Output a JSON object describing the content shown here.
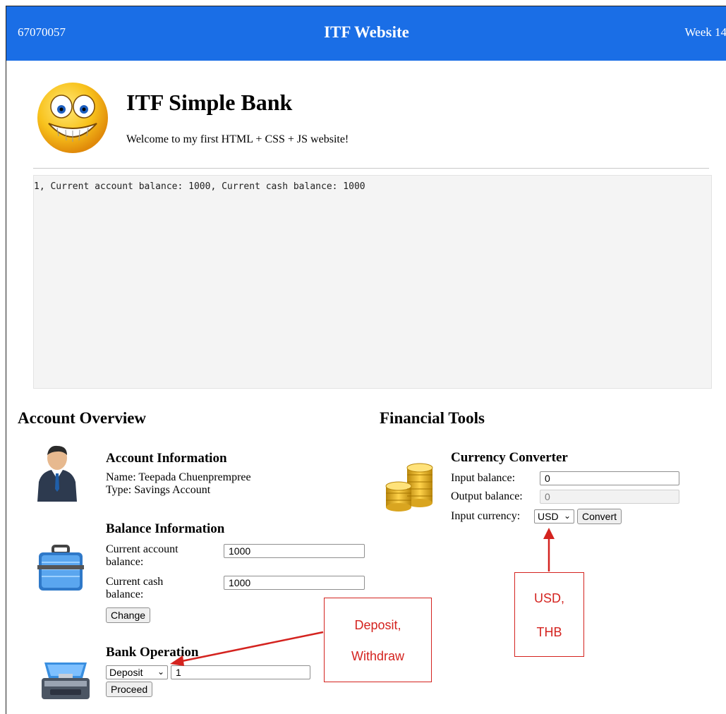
{
  "header": {
    "student_id": "67070057",
    "site_title": "ITF Website",
    "week": "Week 14"
  },
  "hero": {
    "title": "ITF Simple Bank",
    "welcome": "Welcome to my first HTML + CSS + JS website!"
  },
  "log": {
    "text": "1, Current account balance: 1000, Current cash balance: 1000"
  },
  "account_overview": {
    "title": "Account Overview",
    "account_information": {
      "title": "Account Information",
      "name": "Name: Teepada Chuenprempree",
      "type": "Type: Savings Account"
    },
    "balance_information": {
      "title": "Balance Information",
      "account_balance_label_1": "Current account",
      "account_balance_label_2": "balance:",
      "account_balance_value": "1000",
      "cash_balance_label_1": "Current cash",
      "cash_balance_label_2": "balance:",
      "cash_balance_value": "1000",
      "change_label": "Change"
    },
    "bank_operation": {
      "title": "Bank Operation",
      "operation_selected": "Deposit",
      "amount_value": "1",
      "proceed_label": "Proceed"
    }
  },
  "financial_tools": {
    "title": "Financial Tools",
    "currency_converter": {
      "title": "Currency Converter",
      "input_balance_label": "Input balance:",
      "input_balance_value": "0",
      "output_balance_label": "Output balance:",
      "output_balance_value": "0",
      "input_currency_label": "Input currency:",
      "currency_selected": "USD",
      "convert_label": "Convert"
    }
  },
  "annotations": {
    "operation_callout_line1": "Deposit,",
    "operation_callout_line2": "Withdraw",
    "currency_callout_line1": "USD,",
    "currency_callout_line2": "THB"
  },
  "colors": {
    "header_bg": "#1a6ee6",
    "annotation_red": "#d4231f"
  },
  "icons": {
    "logo": "grinning-smiley-icon",
    "account": "businessman-icon",
    "balance": "briefcase-icon",
    "operation": "toolbox-icon",
    "tools": "gold-coins-icon"
  }
}
